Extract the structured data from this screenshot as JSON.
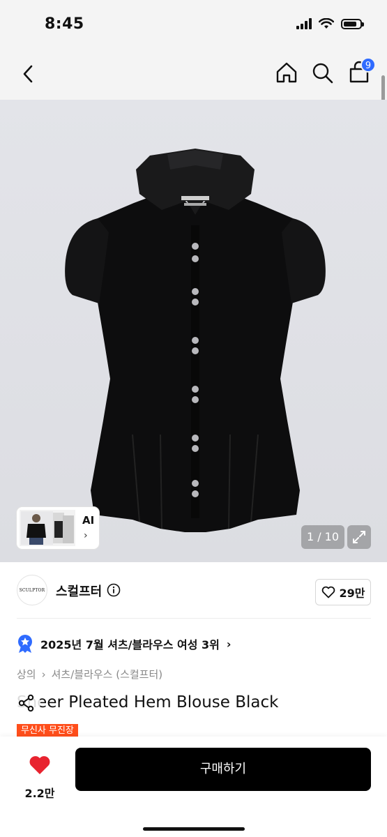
{
  "status": {
    "time": "8:45",
    "icons": [
      "signal-icon",
      "wifi-icon",
      "battery-icon"
    ]
  },
  "nav": {
    "back_icon": "chevron-left-icon",
    "home_icon": "home-icon",
    "search_icon": "search-icon",
    "cart_icon": "cart-icon",
    "cart_badge": "9",
    "badge_color": "#2f6bff"
  },
  "gallery": {
    "ai_label": "AI",
    "ai_chevron": "›",
    "counter": "1 / 10",
    "expand_icon": "expand-icon",
    "current": 1,
    "total": 10
  },
  "brand": {
    "logo_text": "SCULPTOR",
    "name": "스컬프터",
    "info_icon": "info-icon",
    "like_icon": "heart-outline-icon",
    "like_count": "29만"
  },
  "ranking": {
    "badge_icon": "rank-badge-icon",
    "text": "2025년 7월 셔츠/블라우스 여성 3위",
    "chevron": "›"
  },
  "breadcrumb": {
    "level1": "상의",
    "sep": "›",
    "level2": "셔츠/블라우스 (스컬프터)"
  },
  "product": {
    "title": "Sheer Pleated Hem Blouse Black",
    "share_icon": "share-icon",
    "tag": "무신사 무진장",
    "tag_color": "#ff4e1b"
  },
  "bottom": {
    "wish_icon": "heart-filled-icon",
    "wish_count": "2.2만",
    "buy_label": "구매하기",
    "wish_color": "#e8232f"
  }
}
